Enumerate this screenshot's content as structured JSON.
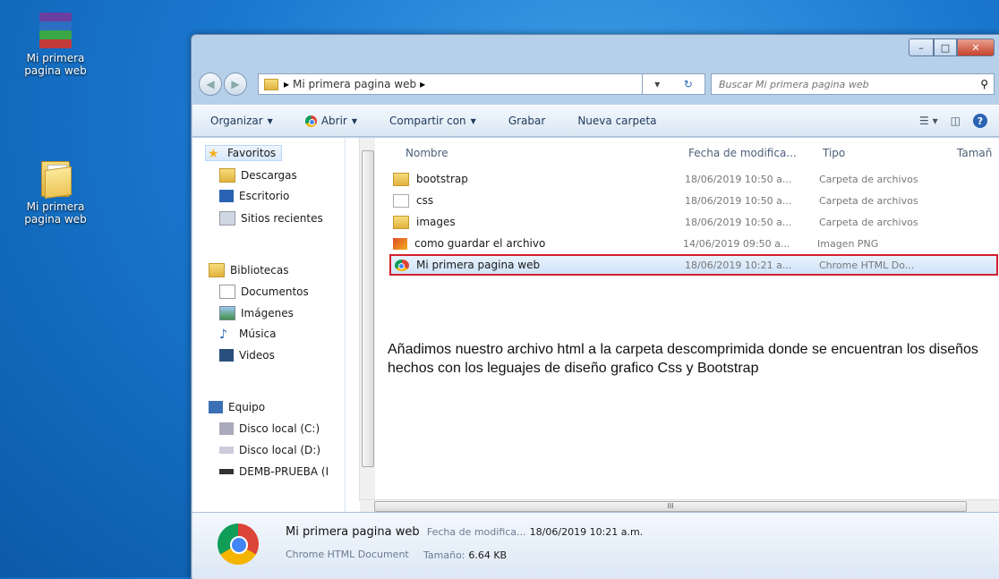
{
  "desktop": {
    "icons": [
      {
        "label": "Mi primera pagina web",
        "kind": "winrar-archive-icon"
      },
      {
        "label": "Mi primera pagina web",
        "kind": "folder-icon"
      }
    ]
  },
  "window": {
    "controls": {
      "minimize": "–",
      "maximize": "□",
      "close": "✕"
    },
    "breadcrumb": [
      "Mi primera pagina web"
    ],
    "search_placeholder": "Buscar Mi primera pagina web",
    "toolbar": {
      "organize": "Organizar",
      "open": "Abrir",
      "share": "Compartir con",
      "burn": "Grabar",
      "new_folder": "Nueva carpeta"
    },
    "nav": {
      "favorites": "Favoritos",
      "downloads": "Descargas",
      "desktop": "Escritorio",
      "recent": "Sitios recientes",
      "libraries": "Bibliotecas",
      "documents": "Documentos",
      "images": "Imágenes",
      "music": "Música",
      "videos": "Videos",
      "computer": "Equipo",
      "disk_c": "Disco local (C:)",
      "disk_d": "Disco local (D:)",
      "usb": "DEMB-PRUEBA (I"
    },
    "columns": {
      "name": "Nombre",
      "date": "Fecha de modifica...",
      "type": "Tipo",
      "size": "Tamañ"
    },
    "files": [
      {
        "name": "bootstrap",
        "date": "18/06/2019 10:50 a...",
        "type": "Carpeta de archivos"
      },
      {
        "name": "css",
        "date": "18/06/2019 10:50 a...",
        "type": "Carpeta de archivos"
      },
      {
        "name": "images",
        "date": "18/06/2019 10:50 a...",
        "type": "Carpeta de archivos"
      },
      {
        "name": "como guardar el archivo",
        "date": "14/06/2019 09:50 a...",
        "type": "Imagen PNG"
      },
      {
        "name": "Mi primera pagina web",
        "date": "18/06/2019 10:21 a...",
        "type": "Chrome HTML Do..."
      }
    ],
    "note": "Añadimos nuestro archivo html a la carpeta descomprimida donde se encuentran los diseños hechos con los leguajes de diseño grafico Css y Bootstrap",
    "hscroll_label": "III",
    "details": {
      "name": "Mi primera pagina web",
      "date_label": "Fecha de modifica...",
      "date_value": "18/06/2019 10:21 a.m.",
      "type": "Chrome HTML Document",
      "size_label": "Tamaño:",
      "size_value": "6.64 KB"
    }
  }
}
